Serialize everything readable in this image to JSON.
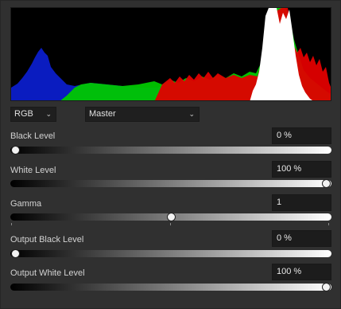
{
  "histogram": {
    "colors": {
      "background": "#000000",
      "red": "#e00000",
      "green": "#00d000",
      "blue": "#0a1cc0",
      "luminance": "#ffffff"
    }
  },
  "channel_select": {
    "value": "RGB"
  },
  "mode_select": {
    "value": "Master"
  },
  "sliders": [
    {
      "label": "Black Level",
      "value": "0 %",
      "position": 0.0
    },
    {
      "label": "White Level",
      "value": "100 %",
      "position": 1.0
    },
    {
      "label": "Gamma",
      "value": "1",
      "position": 0.5
    },
    {
      "label": "Output Black Level",
      "value": "0 %",
      "position": 0.0
    },
    {
      "label": "Output White Level",
      "value": "100 %",
      "position": 1.0
    }
  ],
  "icons": {
    "dropdown": "chevron-down-icon"
  }
}
